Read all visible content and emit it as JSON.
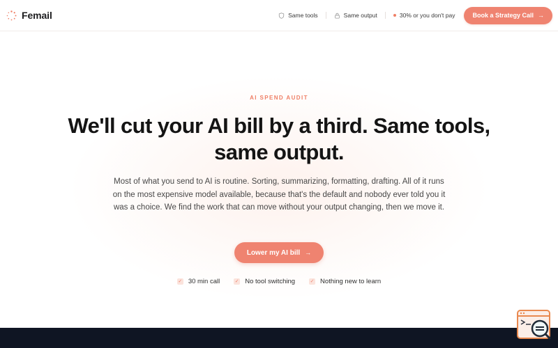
{
  "brand": {
    "name": "Femail",
    "logo_icon": "dotted-ring-logo",
    "accent": "#EF8370"
  },
  "header": {
    "badges": [
      {
        "icon": "shield-icon",
        "label": "Same tools"
      },
      {
        "icon": "lock-icon",
        "label": "Same output"
      },
      {
        "icon": "dot-icon",
        "label": "30% or you don't pay"
      }
    ],
    "cta_label": "Book a Strategy Call",
    "cta_icon": "arrow-right-icon"
  },
  "hero": {
    "eyebrow": "AI SPEND AUDIT",
    "headline": "We'll cut your AI bill by a third. Same tools, same output.",
    "subtext": "Most of what you send to AI is routine. Sorting, summarizing, formatting, drafting. All of it runs on the most expensive model available, because that's the default and nobody ever told you it was a choice. We find the work that can move without your output changing, then we move it.",
    "cta_label": "Lower my AI bill",
    "cta_icon": "arrow-right-icon",
    "features": [
      {
        "icon": "check-icon",
        "label": "30 min call"
      },
      {
        "icon": "check-icon",
        "label": "No tool switching"
      },
      {
        "icon": "check-icon",
        "label": "Nothing new to learn"
      }
    ]
  },
  "widget": {
    "icon": "search-chat-widget-icon"
  }
}
